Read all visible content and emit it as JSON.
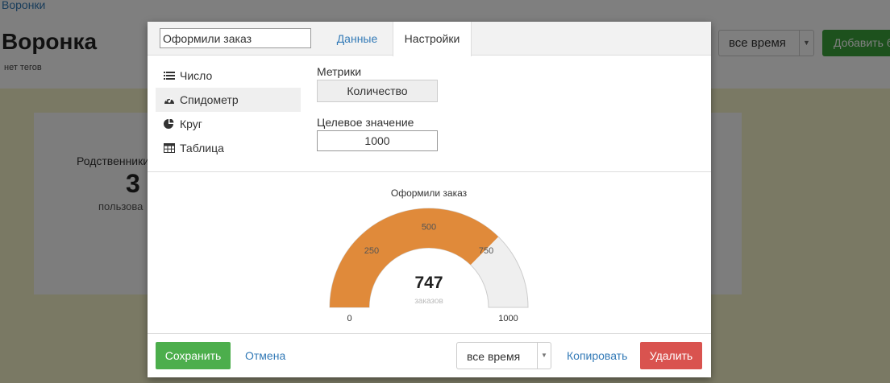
{
  "background": {
    "breadcrumb": "Воронки",
    "title": "Воронка",
    "tags": "нет тегов",
    "date_range": "все время",
    "add_button": "Добавить б",
    "card": {
      "title": "Родственники",
      "value": "3",
      "subtitle": "пользова"
    }
  },
  "modal": {
    "widget_name": "Оформили заказ",
    "tabs": [
      {
        "label": "Данные",
        "active": false
      },
      {
        "label": "Настройки",
        "active": true
      }
    ],
    "types": [
      {
        "label": "Число",
        "icon": "list-icon",
        "active": false
      },
      {
        "label": "Спидометр",
        "icon": "speedometer-icon",
        "active": true
      },
      {
        "label": "Круг",
        "icon": "pie-chart-icon",
        "active": false
      },
      {
        "label": "Таблица",
        "icon": "table-icon",
        "active": false
      }
    ],
    "metrics_label": "Метрики",
    "metric_value": "Количество",
    "target_label": "Целевое значение",
    "target_value": "1000",
    "footer": {
      "save": "Сохранить",
      "cancel": "Отмена",
      "date_range": "все время",
      "copy": "Копировать",
      "delete": "Удалить"
    }
  },
  "chart_data": {
    "type": "gauge",
    "title": "Оформили заказ",
    "value": 747,
    "value_label": "заказов",
    "min": 0,
    "max": 1000,
    "ticks": [
      250,
      500,
      750
    ],
    "min_label": "0",
    "max_label": "1000",
    "fill_color": "#e08a3a",
    "track_color": "#efefef"
  }
}
